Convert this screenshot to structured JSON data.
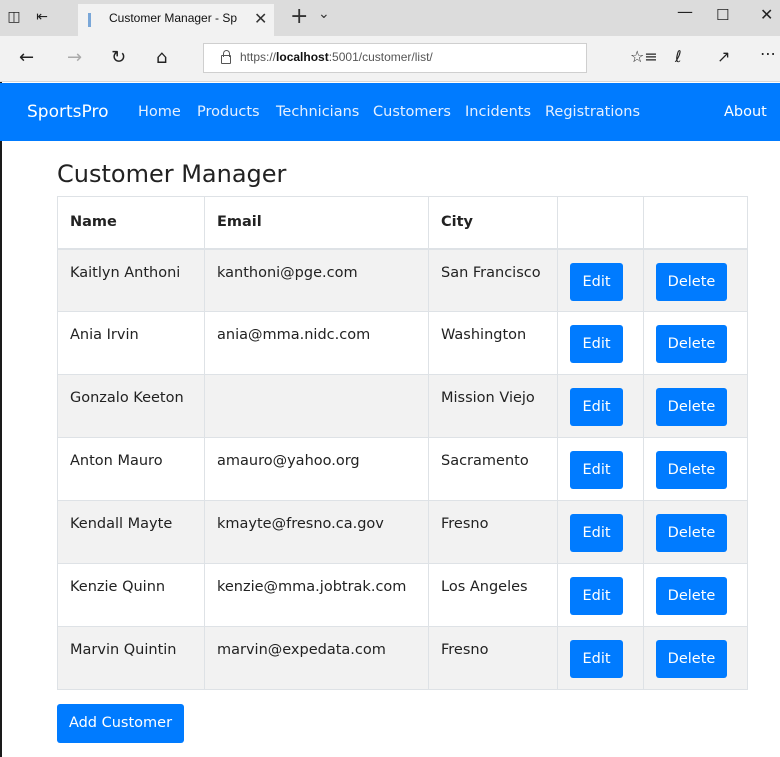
{
  "browser": {
    "tab_title": "Customer Manager - Sp",
    "url_prefix": "https://",
    "url_host": "localhost",
    "url_rest": ":5001/customer/list/",
    "icons": [
      "tab-actions-icon",
      "set-aside-tabs-icon",
      "favicon-icon",
      "close-tab-icon",
      "new-tab-icon",
      "tab-menu-icon",
      "minimize-icon",
      "maximize-icon",
      "close-window-icon",
      "back-icon",
      "forward-icon",
      "refresh-icon",
      "home-icon",
      "lock-icon",
      "favorites-icon",
      "pen-icon",
      "share-icon",
      "more-icon"
    ]
  },
  "navbar": {
    "brand": "SportsPro",
    "links": [
      "Home",
      "Products",
      "Technicians",
      "Customers",
      "Incidents",
      "Registrations"
    ],
    "about": "About",
    "color": "#007bff"
  },
  "main": {
    "title": "Customer Manager",
    "columns": [
      "Name",
      "Email",
      "City",
      "",
      ""
    ],
    "rows": [
      {
        "name": "Kaitlyn Anthoni",
        "email": "kanthoni@pge.com",
        "city": "San Francisco"
      },
      {
        "name": "Ania Irvin",
        "email": "ania@mma.nidc.com",
        "city": "Washington"
      },
      {
        "name": "Gonzalo Keeton",
        "email": "",
        "city": "Mission Viejo"
      },
      {
        "name": "Anton Mauro",
        "email": "amauro@yahoo.org",
        "city": "Sacramento"
      },
      {
        "name": "Kendall Mayte",
        "email": "kmayte@fresno.ca.gov",
        "city": "Fresno"
      },
      {
        "name": "Kenzie Quinn",
        "email": "kenzie@mma.jobtrak.com",
        "city": "Los Angeles"
      },
      {
        "name": "Marvin Quintin",
        "email": "marvin@expedata.com",
        "city": "Fresno"
      }
    ],
    "edit_label": "Edit",
    "delete_label": "Delete",
    "add_label": "Add Customer",
    "button_color": "#007bff",
    "stripe_color": "#f2f2f2"
  }
}
